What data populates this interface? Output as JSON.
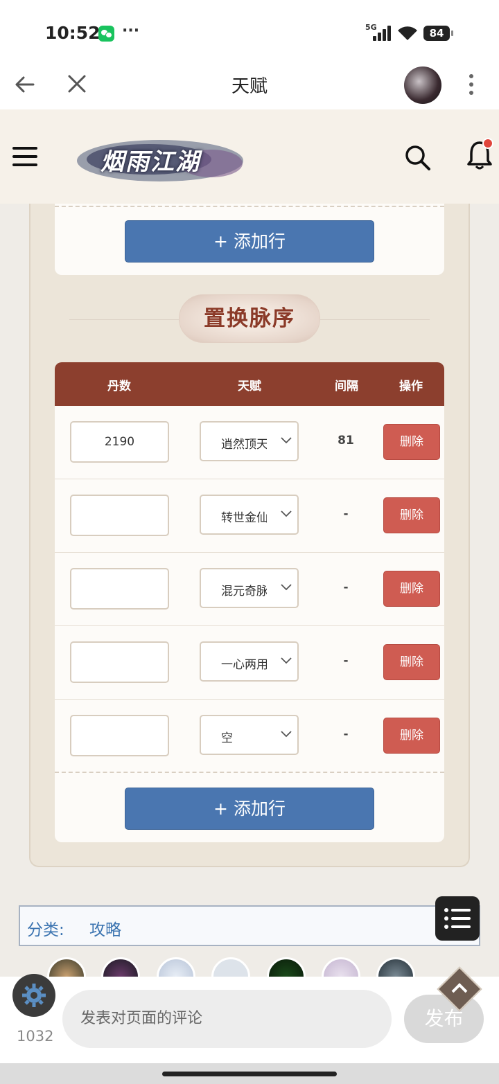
{
  "status": {
    "time": "10:52",
    "dots": "···",
    "network": "5G",
    "battery": "84"
  },
  "nav": {
    "title": "天赋"
  },
  "section": {
    "title": "置换脉序",
    "add_row_label": "+ 添加行"
  },
  "table": {
    "headers": [
      "丹数",
      "天赋",
      "间隔",
      "操作"
    ],
    "rows": [
      {
        "dan": "2190",
        "talent": "逍然顶天",
        "gap": "81",
        "action": "删除"
      },
      {
        "dan": "",
        "talent": "转世金仙",
        "gap": "-",
        "action": "删除"
      },
      {
        "dan": "",
        "talent": "混元奇脉",
        "gap": "-",
        "action": "删除"
      },
      {
        "dan": "",
        "talent": "一心两用",
        "gap": "-",
        "action": "删除"
      },
      {
        "dan": "",
        "talent": "空",
        "gap": "-",
        "action": "删除"
      }
    ]
  },
  "category": {
    "label": "分类:",
    "link": "攻略"
  },
  "comments": {
    "count": "1032",
    "placeholder": "发表对页面的评论",
    "publish": "发布"
  },
  "colors": {
    "header_bg": "#8c3f2e",
    "add_button": "#4a76b0",
    "delete_button": "#cf5c52",
    "link": "#3a73b0"
  }
}
